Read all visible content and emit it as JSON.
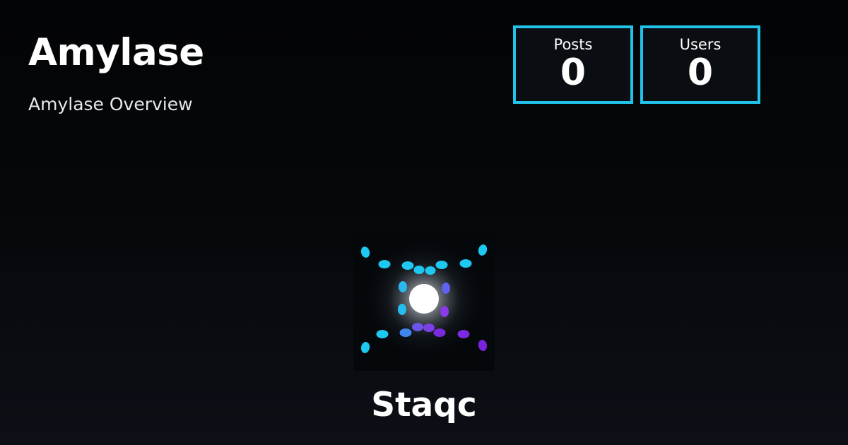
{
  "header": {
    "title": "Amylase",
    "subtitle": "Amylase Overview"
  },
  "stats": [
    {
      "label": "Posts",
      "value": "0"
    },
    {
      "label": "Users",
      "value": "0"
    }
  ],
  "organization": {
    "name": "Staqc",
    "logo_icon": "glowing-orb-dots-icon"
  },
  "colors": {
    "accent": "#22c3ea",
    "logo_dot_cyan": "#1ec8f0",
    "logo_dot_violet": "#7a2be0"
  }
}
